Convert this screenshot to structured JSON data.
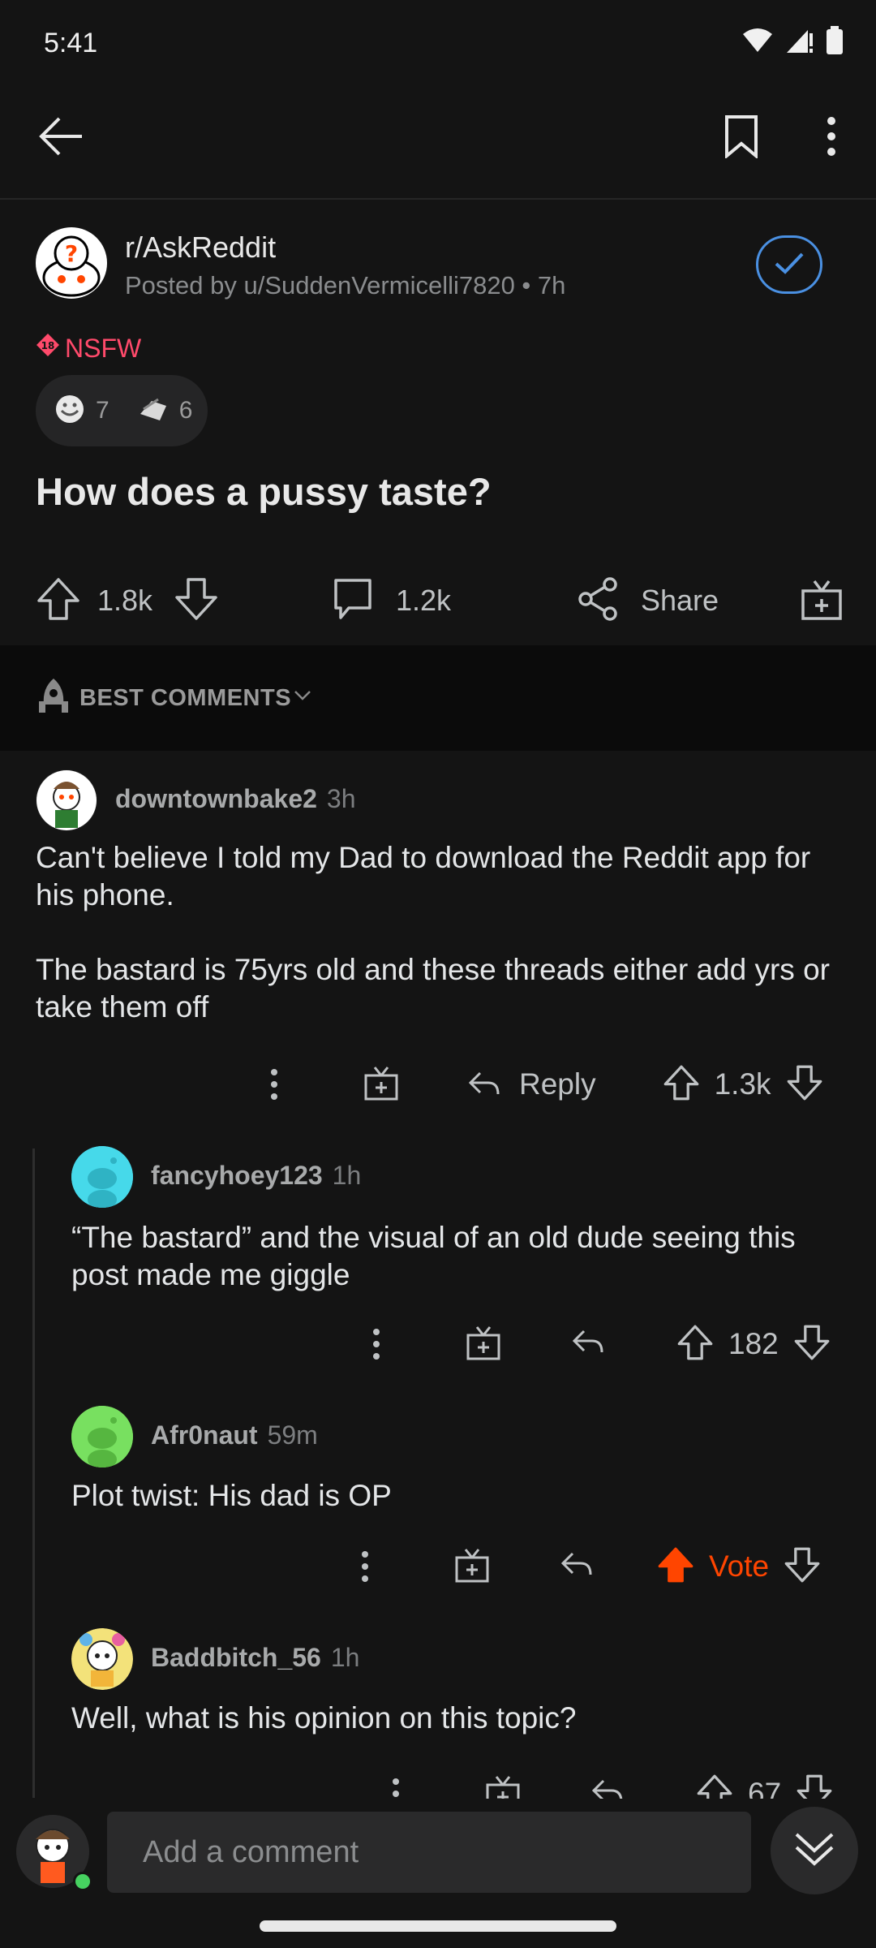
{
  "status": {
    "time": "5:41"
  },
  "post": {
    "subreddit": "r/AskReddit",
    "posted_by": "Posted by u/SuddenVermicelli7820 • 7h",
    "nsfw": "NSFW",
    "awards": [
      {
        "icon": "wholesome-award-icon",
        "count": "7"
      },
      {
        "icon": "helpful-award-icon",
        "count": "6"
      }
    ],
    "title": "How does a pussy taste?",
    "upvotes": "1.8k",
    "comments": "1.2k",
    "share_label": "Share"
  },
  "sort": {
    "label": "BEST COMMENTS"
  },
  "comments": [
    {
      "user": "downtownbake2",
      "time": "3h",
      "body": "Can't believe I told my Dad to download the Reddit app for his phone.\n\nThe bastard is 75yrs old and these threads either add yrs or take them off",
      "reply_label": "Reply",
      "votes": "1.3k"
    },
    {
      "user": "fancyhoey123",
      "time": "1h",
      "body": "“The bastard” and the visual of an old dude seeing this post made me giggle",
      "votes": "182"
    },
    {
      "user": "Afr0naut",
      "time": "59m",
      "body": "Plot twist: His dad is OP",
      "votes": "Vote"
    },
    {
      "user": "Baddbitch_56",
      "time": "1h",
      "body": "Well, what is his opinion on this topic?",
      "votes": "67"
    }
  ],
  "composer": {
    "placeholder": "Add a comment"
  },
  "colors": {
    "background": "#141414",
    "accent_blue": "#4a90e2",
    "upvote_orange": "#ff4500",
    "nsfw_red": "#ff4a6b"
  }
}
